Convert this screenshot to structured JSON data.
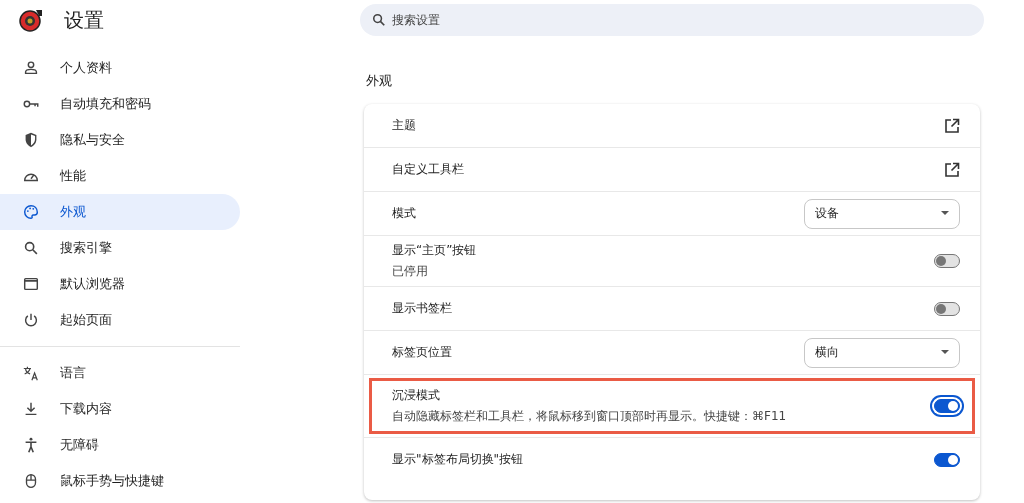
{
  "header": {
    "title": "设置"
  },
  "sidebar": {
    "groups": [
      {
        "items": [
          {
            "label": "个人资料",
            "selected": false
          },
          {
            "label": "自动填充和密码",
            "selected": false
          },
          {
            "label": "隐私与安全",
            "selected": false
          },
          {
            "label": "性能",
            "selected": false
          },
          {
            "label": "外观",
            "selected": true
          },
          {
            "label": "搜索引擎",
            "selected": false
          },
          {
            "label": "默认浏览器",
            "selected": false
          },
          {
            "label": "起始页面",
            "selected": false
          }
        ]
      },
      {
        "items": [
          {
            "label": "语言",
            "selected": false
          },
          {
            "label": "下载内容",
            "selected": false
          },
          {
            "label": "无障碍",
            "selected": false
          },
          {
            "label": "鼠标手势与快捷键",
            "selected": false
          }
        ]
      }
    ]
  },
  "search": {
    "placeholder": "搜索设置"
  },
  "section": {
    "title": "外观",
    "rows": [
      {
        "kind": "link",
        "label": "主题"
      },
      {
        "kind": "link",
        "label": "自定义工具栏"
      },
      {
        "kind": "select",
        "label": "模式",
        "value": "设备"
      },
      {
        "kind": "toggle",
        "label": "显示“主页”按钮",
        "sublabel": "已停用",
        "on": false
      },
      {
        "kind": "toggle",
        "label": "显示书签栏",
        "on": false
      },
      {
        "kind": "select",
        "label": "标签页位置",
        "value": "横向"
      },
      {
        "kind": "toggle",
        "label": "沉浸模式",
        "sublabel": "自动隐藏标签栏和工具栏，将鼠标移到窗口顶部时再显示。快捷键：⌘F11",
        "on": true,
        "highlighted": true,
        "focused": true
      },
      {
        "kind": "toggle",
        "label": "显示\"标签布局切换\"按钮",
        "on": true
      }
    ]
  }
}
